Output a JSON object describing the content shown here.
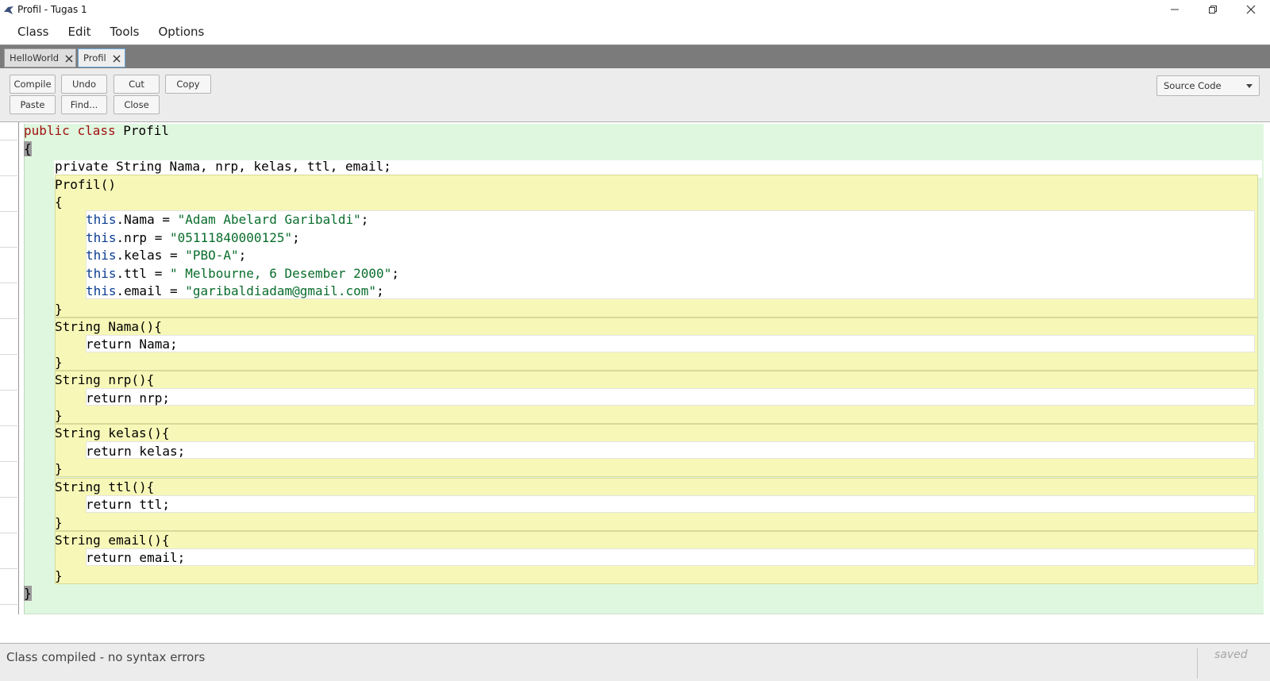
{
  "window": {
    "title": "Profil - Tugas 1"
  },
  "menu": [
    "Class",
    "Edit",
    "Tools",
    "Options"
  ],
  "tabs": [
    {
      "label": "HelloWorld",
      "active": false
    },
    {
      "label": "Profil",
      "active": true
    }
  ],
  "toolbar": {
    "compile": "Compile",
    "undo": "Undo",
    "cut": "Cut",
    "copy": "Copy",
    "paste": "Paste",
    "find": "Find...",
    "close": "Close",
    "view_selected": "Source Code"
  },
  "code": {
    "line1_kw": "public",
    "line1_kw2": "class",
    "line1_name": "Profil",
    "open_brace": "{",
    "field_decl": "private String Nama, nrp, kelas, ttl, email;",
    "ctor_sig": "Profil()",
    "ctor_open": "{",
    "assign_nama_field": ".Nama = ",
    "assign_nama_val": "\"Adam Abelard Garibaldi\"",
    "assign_nrp_field": ".nrp = ",
    "assign_nrp_val": "\"05111840000125\"",
    "assign_kelas_field": ".kelas = ",
    "assign_kelas_val": "\"PBO-A\"",
    "assign_ttl_field": ".ttl = ",
    "assign_ttl_val": "\" Melbourne, 6 Desember 2000\"",
    "assign_email_field": ".email = ",
    "assign_email_val": "\"garibaldiadam@gmail.com\"",
    "this_kw": "this",
    "semicolon": ";",
    "close_brace": "}",
    "getter_nama_sig": "String Nama(){",
    "getter_nama_body": "return Nama;",
    "getter_nrp_sig": "String nrp(){",
    "getter_nrp_body": "return nrp;",
    "getter_kelas_sig": "String kelas(){",
    "getter_kelas_body": "return kelas;",
    "getter_ttl_sig": "String ttl(){",
    "getter_ttl_body": "return ttl;",
    "getter_email_sig": "String email(){",
    "getter_email_body": "return email;"
  },
  "status": {
    "message": "Class compiled - no syntax errors",
    "saved": "saved"
  },
  "colors": {
    "class_scope": "#e0f7df",
    "method_scope": "#f7f7b8",
    "keyword": "#a01010",
    "string": "#0a6d2c",
    "this_keyword": "#0b3d91"
  }
}
